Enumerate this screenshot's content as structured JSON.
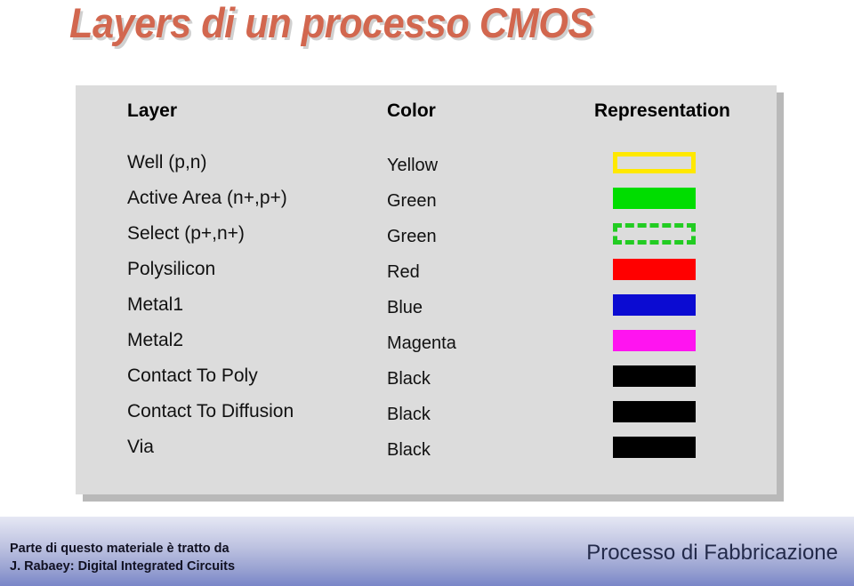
{
  "slide": {
    "title": "Layers di un processo CMOS",
    "title_color": "#D2674F",
    "background": "#FFFFFF"
  },
  "table": {
    "panel_color": "#DCDCDC",
    "shadow_color": "#B9B9B9",
    "headers": {
      "layer": "Layer",
      "color": "Color",
      "representation": "Representation"
    },
    "rows": [
      {
        "layer": "Well (p,n)",
        "color": "Yellow",
        "swatch": {
          "style": "outline",
          "stroke": "#FFE800",
          "fill": "transparent",
          "border_width": "5px"
        }
      },
      {
        "layer": "Active Area (n+,p+)",
        "color": "Green",
        "swatch": {
          "style": "solid",
          "stroke": "#00D400",
          "fill": "#00DD00",
          "border_width": "0px"
        }
      },
      {
        "layer": "Select (p+,n+)",
        "color": "Green",
        "swatch": {
          "style": "dashed",
          "stroke": "#22CC22",
          "fill": "transparent",
          "border_width": "5px"
        }
      },
      {
        "layer": "Polysilicon",
        "color": "Red",
        "swatch": {
          "style": "solid",
          "stroke": "#FF0000",
          "fill": "#FF0000",
          "border_width": "0px"
        }
      },
      {
        "layer": "Metal1",
        "color": "Blue",
        "swatch": {
          "style": "solid",
          "stroke": "#0B0BD2",
          "fill": "#0B0BD2",
          "border_width": "0px"
        }
      },
      {
        "layer": "Metal2",
        "color": "Magenta",
        "swatch": {
          "style": "solid",
          "stroke": "#FF14F0",
          "fill": "#FF14F0",
          "border_width": "0px"
        }
      },
      {
        "layer": "Contact To Poly",
        "color": "Black",
        "swatch": {
          "style": "solid",
          "stroke": "#000000",
          "fill": "#000000",
          "border_width": "0px"
        }
      },
      {
        "layer": "Contact To Diffusion",
        "color": "Black",
        "swatch": {
          "style": "solid",
          "stroke": "#000000",
          "fill": "#000000",
          "border_width": "0px"
        }
      },
      {
        "layer": "Via",
        "color": "Black",
        "swatch": {
          "style": "solid",
          "stroke": "#000000",
          "fill": "#000000",
          "border_width": "0px"
        }
      }
    ]
  },
  "footer": {
    "credit_line1": "Parte di questo materiale è tratto da",
    "credit_line2": "J. Rabaey: Digital Integrated Circuits",
    "section": "Processo di Fabbricazione",
    "gradient_top": "#E6E8F4",
    "gradient_bottom": "#7986C8"
  }
}
